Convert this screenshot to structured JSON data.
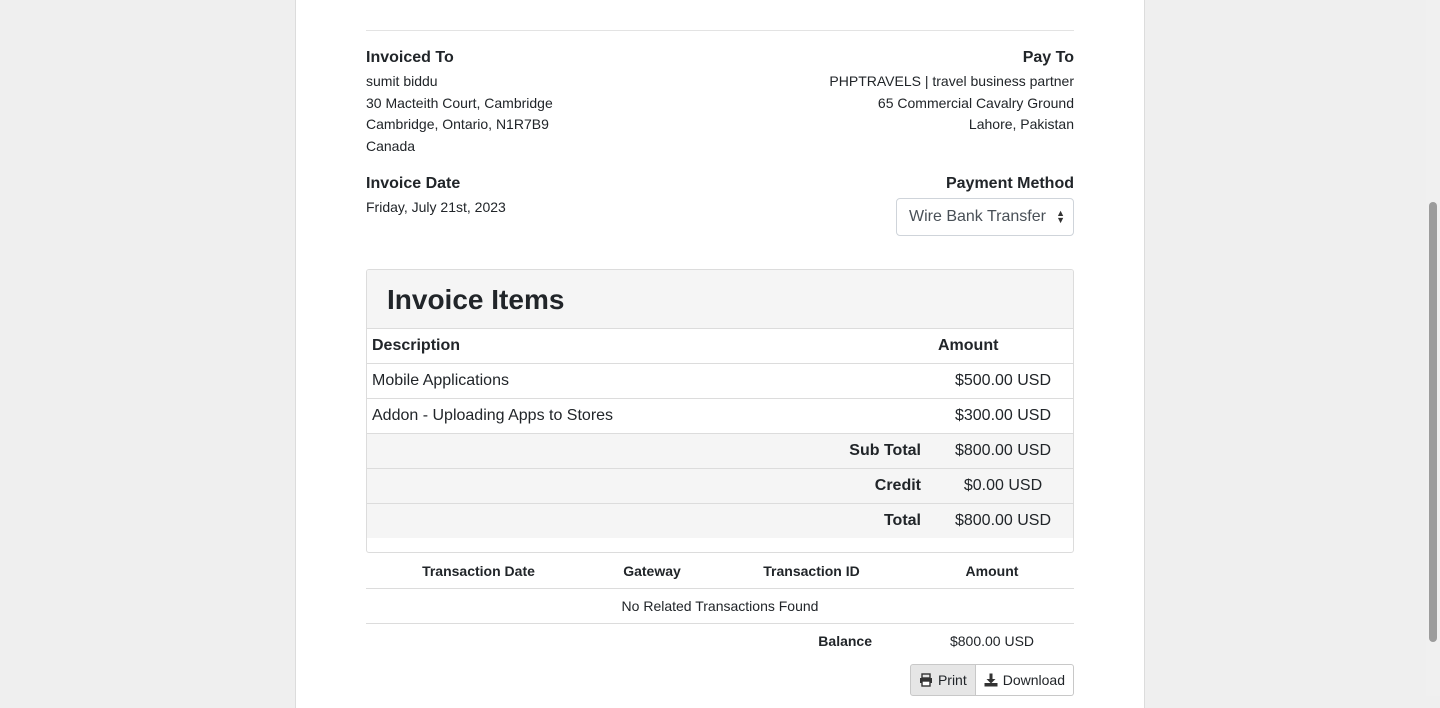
{
  "invoiced_to": {
    "heading": "Invoiced To",
    "lines": [
      "sumit biddu",
      "30 Macteith Court, Cambridge",
      "Cambridge, Ontario, N1R7B9",
      "Canada"
    ]
  },
  "pay_to": {
    "heading": "Pay To",
    "lines": [
      "PHPTRAVELS | travel business partner",
      "65 Commercial Cavalry Ground",
      "Lahore, Pakistan"
    ]
  },
  "invoice_date": {
    "heading": "Invoice Date",
    "value": "Friday, July 21st, 2023"
  },
  "payment_method": {
    "heading": "Payment Method",
    "selected": "Wire Bank Transfer"
  },
  "items_panel": {
    "title": "Invoice Items",
    "col_description": "Description",
    "col_amount": "Amount",
    "items": [
      {
        "description": "Mobile Applications",
        "amount": "$500.00 USD"
      },
      {
        "description": "Addon - Uploading Apps to Stores",
        "amount": "$300.00 USD"
      }
    ],
    "sub_total_label": "Sub Total",
    "sub_total": "$800.00 USD",
    "credit_label": "Credit",
    "credit": "$0.00 USD",
    "total_label": "Total",
    "total": "$800.00 USD"
  },
  "transactions": {
    "headers": [
      "Transaction Date",
      "Gateway",
      "Transaction ID",
      "Amount"
    ],
    "empty_message": "No Related Transactions Found",
    "balance_label": "Balance",
    "balance": "$800.00 USD"
  },
  "actions": {
    "print_label": "Print",
    "download_label": "Download"
  },
  "icons": {
    "print": "printer-icon",
    "download": "download-icon"
  }
}
